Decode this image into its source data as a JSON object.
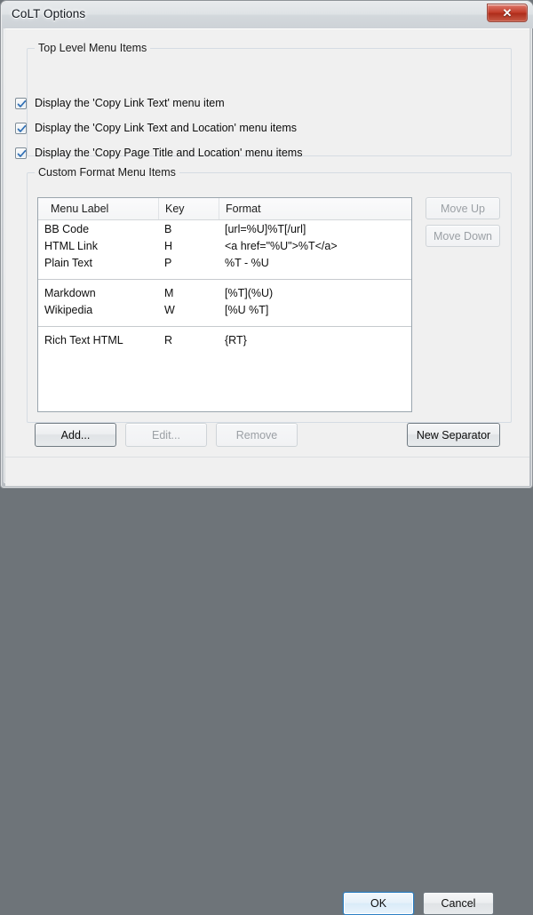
{
  "window": {
    "title": "CoLT Options",
    "close_glyph": "✕"
  },
  "top_level_group": {
    "title": "Top Level Menu Items",
    "checkboxes": [
      {
        "label": "Display the 'Copy Link Text' menu item",
        "checked": true
      },
      {
        "label": "Display the 'Copy Link Text and Location' menu items",
        "checked": true
      },
      {
        "label": "Display the 'Copy Page Title and Location' menu items",
        "checked": true
      }
    ]
  },
  "custom_format_group": {
    "title": "Custom Format Menu Items",
    "columns": [
      "Menu Label",
      "Key",
      "Format"
    ],
    "rows": [
      {
        "type": "item",
        "label": "BB Code",
        "key": "B",
        "format": "[url=%U]%T[/url]"
      },
      {
        "type": "item",
        "label": "HTML Link",
        "key": "H",
        "format": "<a href=\"%U\">%T</a>"
      },
      {
        "type": "item",
        "label": "Plain Text",
        "key": "P",
        "format": "%T - %U"
      },
      {
        "type": "separator"
      },
      {
        "type": "item",
        "label": "Markdown",
        "key": "M",
        "format": "[%T](%U)"
      },
      {
        "type": "item",
        "label": "Wikipedia",
        "key": "W",
        "format": "[%U %T]"
      },
      {
        "type": "separator"
      },
      {
        "type": "item",
        "label": "Rich Text HTML",
        "key": "R",
        "format": "{RT}"
      }
    ],
    "side_buttons": [
      {
        "label": "Move Up",
        "enabled": false
      },
      {
        "label": "Move Down",
        "enabled": false
      }
    ],
    "action_buttons": [
      {
        "label": "Add...",
        "enabled": true
      },
      {
        "label": "Edit...",
        "enabled": false
      },
      {
        "label": "Remove",
        "enabled": false
      },
      {
        "label": "New Separator",
        "enabled": true
      }
    ]
  },
  "footer": {
    "ok_label": "OK",
    "cancel_label": "Cancel"
  },
  "colors": {
    "accent": "#2c80c4",
    "check_mark": "#2f6fb5",
    "dialog_background": "#f0f0f0",
    "close_button": "#c13a27"
  }
}
